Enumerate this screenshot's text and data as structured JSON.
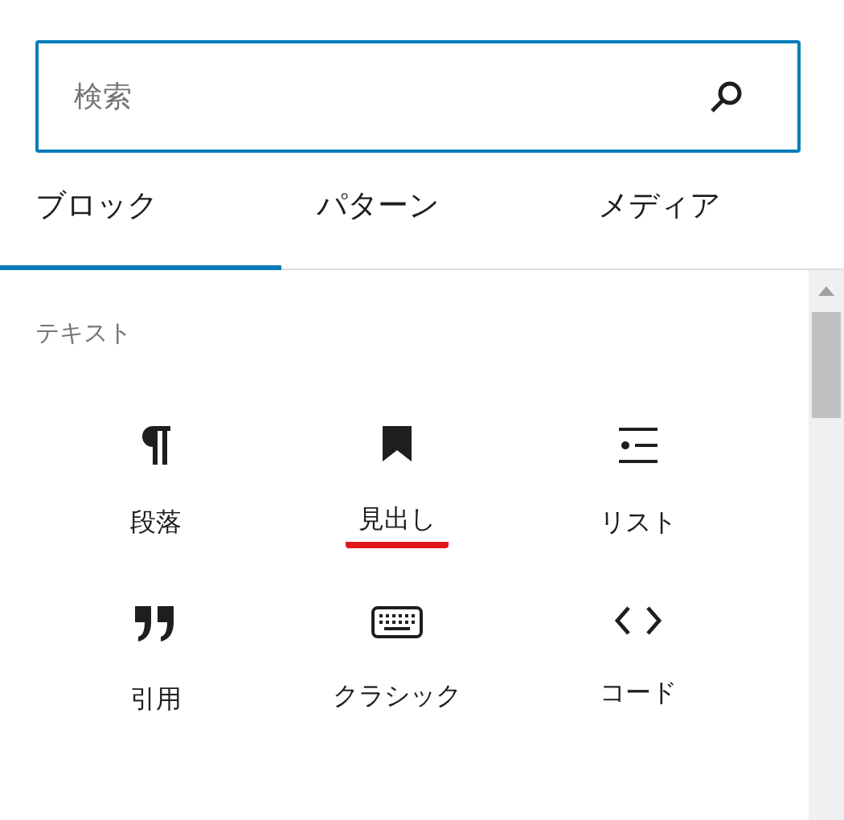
{
  "search": {
    "placeholder": "検索"
  },
  "tabs": [
    {
      "label": "ブロック",
      "selected": true
    },
    {
      "label": "パターン",
      "selected": false
    },
    {
      "label": "メディア",
      "selected": false
    }
  ],
  "category": "テキスト",
  "blocks": [
    {
      "kind": "paragraph",
      "label": "段落",
      "highlighted": false
    },
    {
      "kind": "heading",
      "label": "見出し",
      "highlighted": true
    },
    {
      "kind": "list",
      "label": "リスト",
      "highlighted": false
    },
    {
      "kind": "quote",
      "label": "引用",
      "highlighted": false
    },
    {
      "kind": "classic",
      "label": "クラシック",
      "highlighted": false
    },
    {
      "kind": "code",
      "label": "コード",
      "highlighted": false
    }
  ]
}
